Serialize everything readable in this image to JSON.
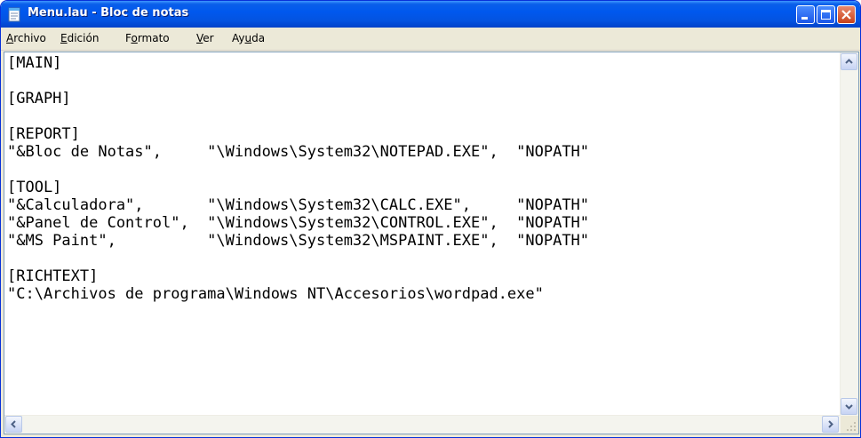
{
  "window": {
    "title": "Menu.lau - Bloc de notas",
    "accent": "#0058ee"
  },
  "menu": {
    "items": [
      {
        "prefix": "",
        "key": "A",
        "rest": "rchivo"
      },
      {
        "prefix": "",
        "key": "E",
        "rest": "dición"
      },
      {
        "prefix": "F",
        "key": "o",
        "rest": "rmato"
      },
      {
        "prefix": "",
        "key": "V",
        "rest": "er"
      },
      {
        "prefix": "Ay",
        "key": "u",
        "rest": "da"
      }
    ]
  },
  "document": {
    "content": "[MAIN]\n\n[GRAPH]\n\n[REPORT]\n\"&Bloc de Notas\",     \"\\Windows\\System32\\NOTEPAD.EXE\",  \"NOPATH\"\n\n[TOOL]\n\"&Calculadora\",       \"\\Windows\\System32\\CALC.EXE\",     \"NOPATH\"\n\"&Panel de Control\",  \"\\Windows\\System32\\CONTROL.EXE\",  \"NOPATH\"\n\"&MS Paint\",          \"\\Windows\\System32\\MSPAINT.EXE\",  \"NOPATH\"\n\n[RICHTEXT]\n\"C:\\Archivos de programa\\Windows NT\\Accesorios\\wordpad.exe\""
  },
  "icons": {
    "app": "notepad-icon",
    "minimize": "minimize-icon",
    "maximize": "maximize-icon",
    "close": "close-icon"
  }
}
